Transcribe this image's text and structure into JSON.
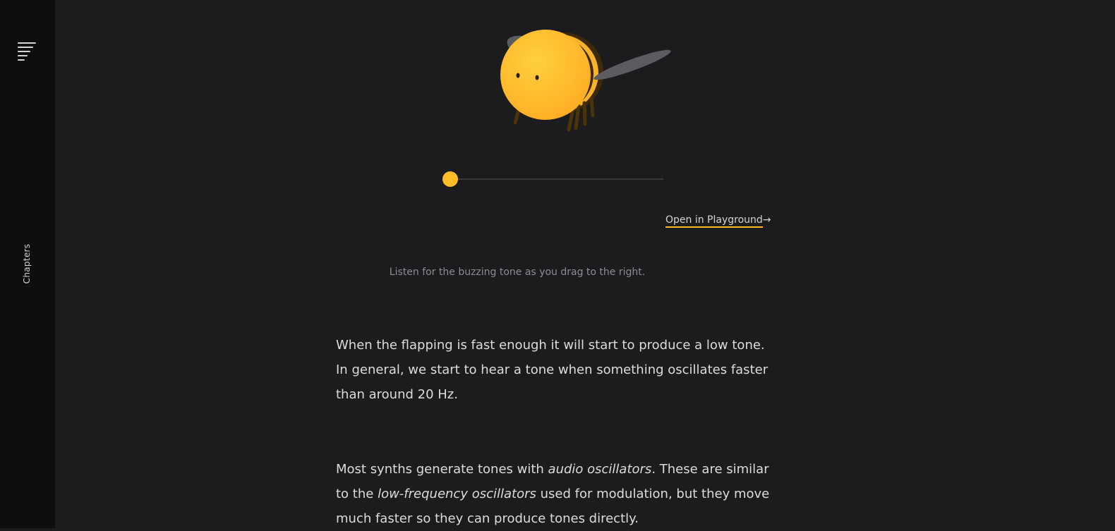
{
  "sidebar": {
    "menu_icon": "menu-lines-icon",
    "chapters_label": "Chapters"
  },
  "demo": {
    "illustration": "bee",
    "slider": {
      "value": 0.0,
      "thumb_color": "#ffbc29",
      "track_color": "#3b3b3e"
    },
    "playground_link_label": "Open in Playground",
    "playground_link_arrow": "→",
    "caption": "Listen for the buzzing tone as you drag to the right."
  },
  "content": {
    "paragraph1": "When the flapping is fast enough it will start to produce a low tone. In general, we start to hear a tone when something oscillates faster than around 20 Hz.",
    "paragraph2": {
      "part1": "Most synths generate tones with ",
      "em1": "audio oscillators",
      "part2": ". These are similar to the ",
      "em2": "low-frequency oscillators",
      "part3": " used for modulation, but they move much faster so they can produce tones directly."
    }
  },
  "colors": {
    "background": "#1c1c1e",
    "sidebar": "#0e0e0e",
    "accent": "#ffbc29",
    "text": "#dcdcde",
    "muted_text": "#8d8d92"
  }
}
